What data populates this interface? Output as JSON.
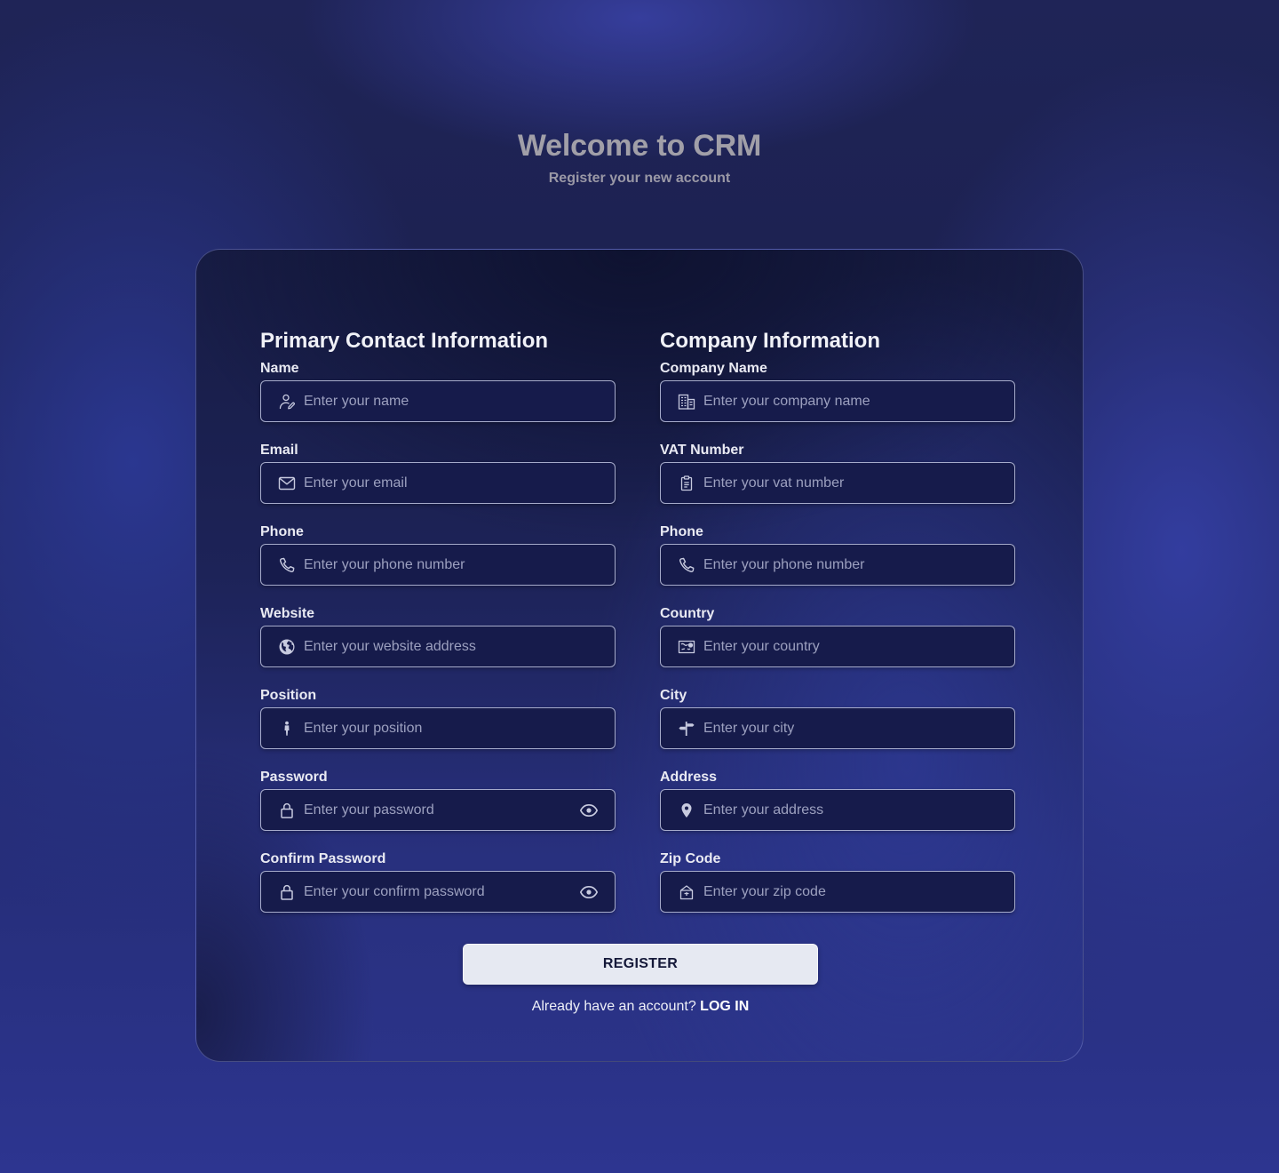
{
  "header": {
    "title": "Welcome to CRM",
    "subtitle": "Register your new account"
  },
  "primary": {
    "heading": "Primary Contact Information",
    "fields": [
      {
        "label": "Name",
        "placeholder": "Enter your name",
        "icon": "user-edit-icon"
      },
      {
        "label": "Email",
        "placeholder": "Enter your email",
        "icon": "envelope-icon"
      },
      {
        "label": "Phone",
        "placeholder": "Enter your phone number",
        "icon": "phone-icon"
      },
      {
        "label": "Website",
        "placeholder": "Enter your website address",
        "icon": "globe-icon"
      },
      {
        "label": "Position",
        "placeholder": "Enter your position",
        "icon": "person-icon"
      },
      {
        "label": "Password",
        "placeholder": "Enter your password",
        "icon": "lock-icon",
        "toggle_icon": "eye-icon"
      },
      {
        "label": "Confirm Password",
        "placeholder": "Enter your confirm password",
        "icon": "lock-icon",
        "toggle_icon": "eye-icon"
      }
    ]
  },
  "company": {
    "heading": "Company Information",
    "fields": [
      {
        "label": "Company Name",
        "placeholder": "Enter your company name",
        "icon": "building-icon"
      },
      {
        "label": "VAT Number",
        "placeholder": "Enter your vat number",
        "icon": "clipboard-icon"
      },
      {
        "label": "Phone",
        "placeholder": "Enter your phone number",
        "icon": "phone-icon"
      },
      {
        "label": "Country",
        "placeholder": "Enter your country",
        "icon": "map-icon"
      },
      {
        "label": "City",
        "placeholder": "Enter your city",
        "icon": "signpost-icon"
      },
      {
        "label": "Address",
        "placeholder": "Enter your address",
        "icon": "map-pin-icon"
      },
      {
        "label": "Zip Code",
        "placeholder": "Enter your zip code",
        "icon": "mailbox-icon"
      }
    ]
  },
  "actions": {
    "register_label": "REGISTER",
    "login_prompt": "Already have an account?",
    "login_link": "LOG IN"
  },
  "colors": {
    "background": "#1f2457",
    "card": "#1d2358",
    "input_bg": "#161b4b",
    "button_bg": "#e6e9f2",
    "title": "#a19fa8"
  }
}
